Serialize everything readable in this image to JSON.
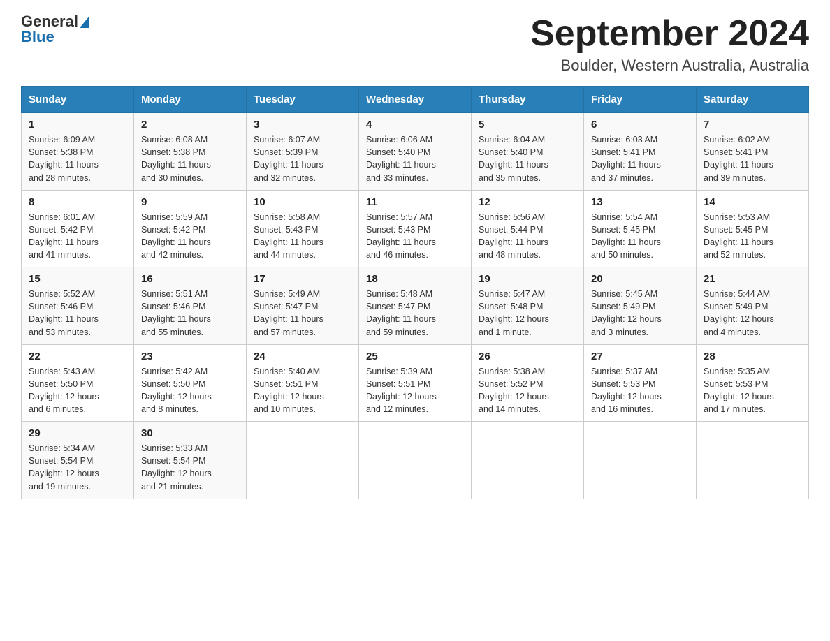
{
  "header": {
    "logo_general": "General",
    "logo_blue": "Blue",
    "title": "September 2024",
    "subtitle": "Boulder, Western Australia, Australia"
  },
  "weekdays": [
    "Sunday",
    "Monday",
    "Tuesday",
    "Wednesday",
    "Thursday",
    "Friday",
    "Saturday"
  ],
  "weeks": [
    [
      {
        "day": "1",
        "sunrise": "6:09 AM",
        "sunset": "5:38 PM",
        "daylight": "11 hours and 28 minutes."
      },
      {
        "day": "2",
        "sunrise": "6:08 AM",
        "sunset": "5:38 PM",
        "daylight": "11 hours and 30 minutes."
      },
      {
        "day": "3",
        "sunrise": "6:07 AM",
        "sunset": "5:39 PM",
        "daylight": "11 hours and 32 minutes."
      },
      {
        "day": "4",
        "sunrise": "6:06 AM",
        "sunset": "5:40 PM",
        "daylight": "11 hours and 33 minutes."
      },
      {
        "day": "5",
        "sunrise": "6:04 AM",
        "sunset": "5:40 PM",
        "daylight": "11 hours and 35 minutes."
      },
      {
        "day": "6",
        "sunrise": "6:03 AM",
        "sunset": "5:41 PM",
        "daylight": "11 hours and 37 minutes."
      },
      {
        "day": "7",
        "sunrise": "6:02 AM",
        "sunset": "5:41 PM",
        "daylight": "11 hours and 39 minutes."
      }
    ],
    [
      {
        "day": "8",
        "sunrise": "6:01 AM",
        "sunset": "5:42 PM",
        "daylight": "11 hours and 41 minutes."
      },
      {
        "day": "9",
        "sunrise": "5:59 AM",
        "sunset": "5:42 PM",
        "daylight": "11 hours and 42 minutes."
      },
      {
        "day": "10",
        "sunrise": "5:58 AM",
        "sunset": "5:43 PM",
        "daylight": "11 hours and 44 minutes."
      },
      {
        "day": "11",
        "sunrise": "5:57 AM",
        "sunset": "5:43 PM",
        "daylight": "11 hours and 46 minutes."
      },
      {
        "day": "12",
        "sunrise": "5:56 AM",
        "sunset": "5:44 PM",
        "daylight": "11 hours and 48 minutes."
      },
      {
        "day": "13",
        "sunrise": "5:54 AM",
        "sunset": "5:45 PM",
        "daylight": "11 hours and 50 minutes."
      },
      {
        "day": "14",
        "sunrise": "5:53 AM",
        "sunset": "5:45 PM",
        "daylight": "11 hours and 52 minutes."
      }
    ],
    [
      {
        "day": "15",
        "sunrise": "5:52 AM",
        "sunset": "5:46 PM",
        "daylight": "11 hours and 53 minutes."
      },
      {
        "day": "16",
        "sunrise": "5:51 AM",
        "sunset": "5:46 PM",
        "daylight": "11 hours and 55 minutes."
      },
      {
        "day": "17",
        "sunrise": "5:49 AM",
        "sunset": "5:47 PM",
        "daylight": "11 hours and 57 minutes."
      },
      {
        "day": "18",
        "sunrise": "5:48 AM",
        "sunset": "5:47 PM",
        "daylight": "11 hours and 59 minutes."
      },
      {
        "day": "19",
        "sunrise": "5:47 AM",
        "sunset": "5:48 PM",
        "daylight": "12 hours and 1 minute."
      },
      {
        "day": "20",
        "sunrise": "5:45 AM",
        "sunset": "5:49 PM",
        "daylight": "12 hours and 3 minutes."
      },
      {
        "day": "21",
        "sunrise": "5:44 AM",
        "sunset": "5:49 PM",
        "daylight": "12 hours and 4 minutes."
      }
    ],
    [
      {
        "day": "22",
        "sunrise": "5:43 AM",
        "sunset": "5:50 PM",
        "daylight": "12 hours and 6 minutes."
      },
      {
        "day": "23",
        "sunrise": "5:42 AM",
        "sunset": "5:50 PM",
        "daylight": "12 hours and 8 minutes."
      },
      {
        "day": "24",
        "sunrise": "5:40 AM",
        "sunset": "5:51 PM",
        "daylight": "12 hours and 10 minutes."
      },
      {
        "day": "25",
        "sunrise": "5:39 AM",
        "sunset": "5:51 PM",
        "daylight": "12 hours and 12 minutes."
      },
      {
        "day": "26",
        "sunrise": "5:38 AM",
        "sunset": "5:52 PM",
        "daylight": "12 hours and 14 minutes."
      },
      {
        "day": "27",
        "sunrise": "5:37 AM",
        "sunset": "5:53 PM",
        "daylight": "12 hours and 16 minutes."
      },
      {
        "day": "28",
        "sunrise": "5:35 AM",
        "sunset": "5:53 PM",
        "daylight": "12 hours and 17 minutes."
      }
    ],
    [
      {
        "day": "29",
        "sunrise": "5:34 AM",
        "sunset": "5:54 PM",
        "daylight": "12 hours and 19 minutes."
      },
      {
        "day": "30",
        "sunrise": "5:33 AM",
        "sunset": "5:54 PM",
        "daylight": "12 hours and 21 minutes."
      },
      null,
      null,
      null,
      null,
      null
    ]
  ],
  "labels": {
    "sunrise": "Sunrise:",
    "sunset": "Sunset:",
    "daylight": "Daylight:"
  }
}
